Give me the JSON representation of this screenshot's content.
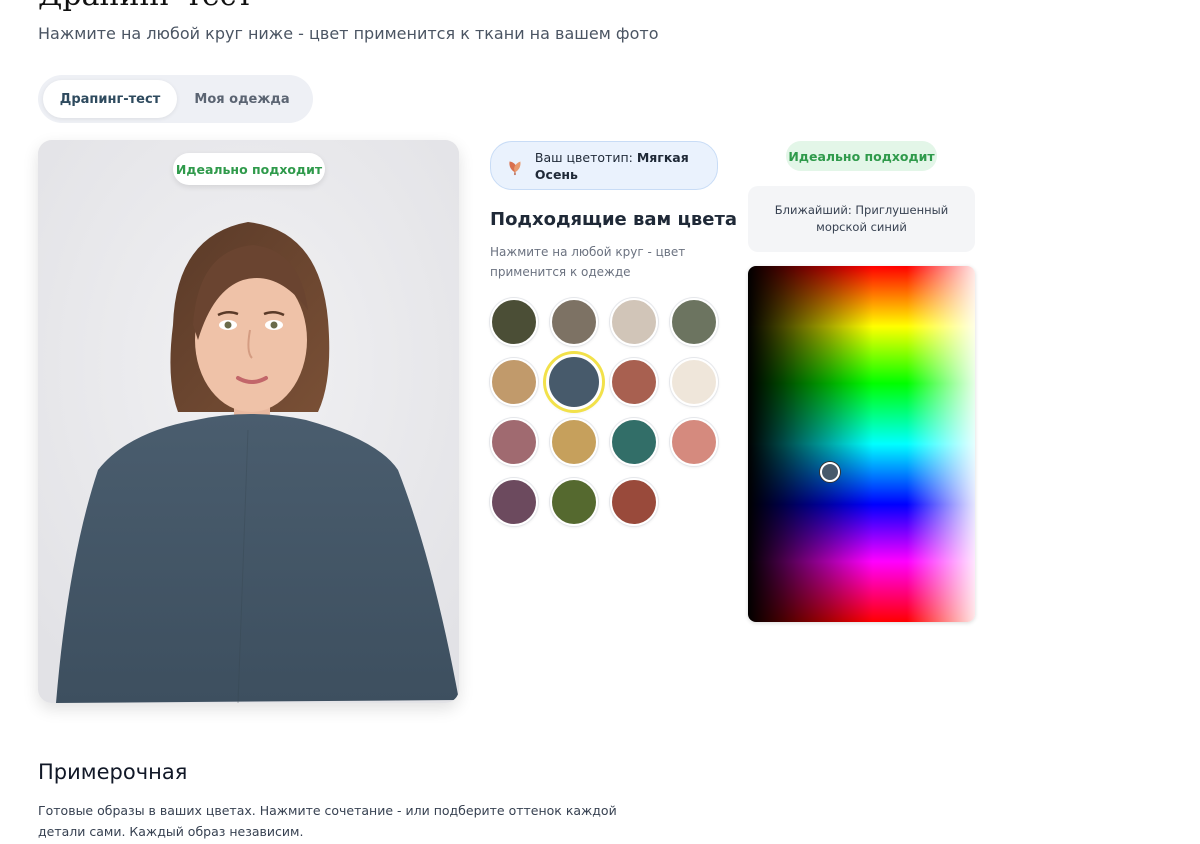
{
  "header": {
    "subtitle": "Нажмите на любой круг ниже - цвет применится к ткани на вашем фото"
  },
  "tabs": [
    {
      "label": "Драпинг-тест",
      "active": true
    },
    {
      "label": "Моя одежда",
      "active": false
    }
  ],
  "photo": {
    "badge": "Идеально подходит",
    "cape_color": "#445566"
  },
  "color_type": {
    "prefix": "Ваш цветотип:",
    "value": "Мягкая Осень",
    "icon": "leaf-icon"
  },
  "palette": {
    "title": "Подходящие вам цвета",
    "hint": "Нажмите на любой круг - цвет применится к одежде",
    "swatches": [
      {
        "color": "#4b4e36"
      },
      {
        "color": "#7d7264"
      },
      {
        "color": "#d1c5b8"
      },
      {
        "color": "#6c7460"
      },
      {
        "color": "#c19a6b"
      },
      {
        "color": "#475a6b",
        "selected": true
      },
      {
        "color": "#a86050"
      },
      {
        "color": "#efe6da"
      },
      {
        "color": "#a06a70"
      },
      {
        "color": "#c6a05c"
      },
      {
        "color": "#326e68"
      },
      {
        "color": "#d58a7e"
      },
      {
        "color": "#6c4a5e"
      },
      {
        "color": "#55692f"
      },
      {
        "color": "#994a3b"
      }
    ]
  },
  "match": {
    "badge": "Идеально подходит",
    "nearest": "Ближайший: Приглушенный морской синий"
  },
  "fitting": {
    "title": "Примерочная",
    "description": "Готовые образы в ваших цветах. Нажмите сочетание - или подберите оттенок каждой детали сами. Каждый образ независим."
  }
}
